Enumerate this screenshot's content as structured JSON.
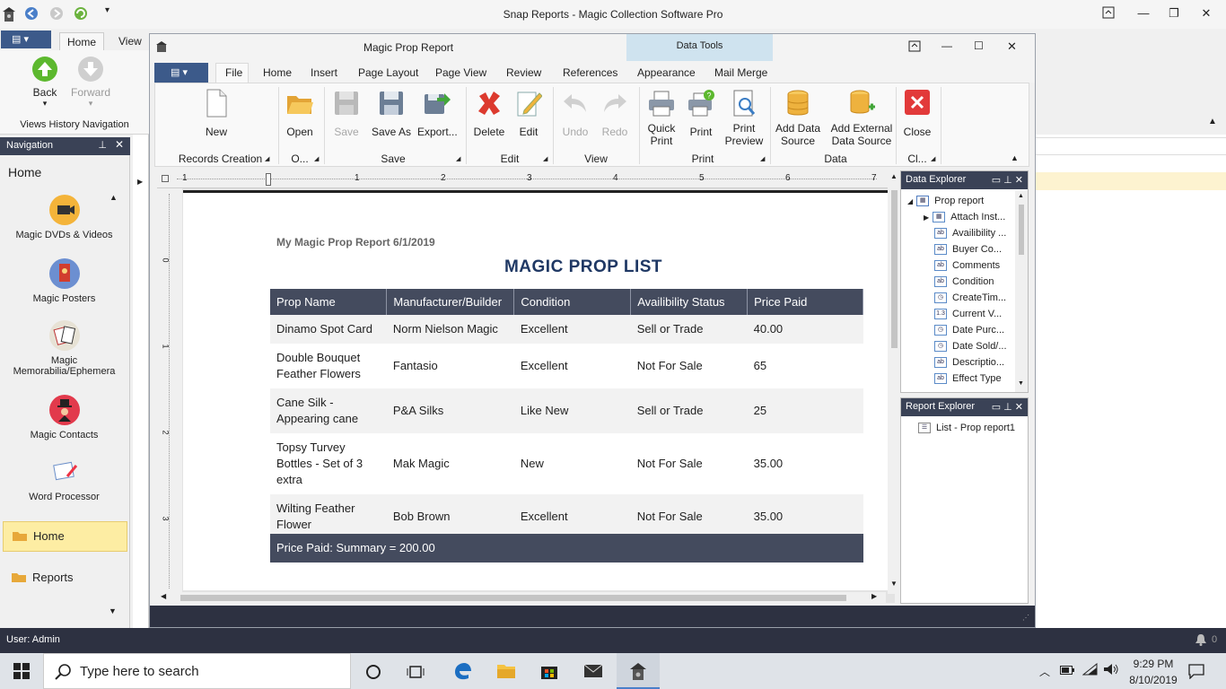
{
  "app": {
    "title": "Snap Reports - Magic Collection Software Pro",
    "tabs": [
      "Home",
      "View"
    ],
    "history": {
      "back": "Back",
      "forward": "Forward",
      "group": "Views History Navigation"
    }
  },
  "navigation": {
    "title": "Navigation",
    "home_label": "Home",
    "items": [
      {
        "label": "Magic DVDs & Videos",
        "icon": "video-camera-icon"
      },
      {
        "label": "Magic Posters",
        "icon": "poster-icon"
      },
      {
        "label": "Magic Memorabilia/Ephemera",
        "icon": "cards-icon"
      },
      {
        "label": "Magic Contacts",
        "icon": "magician-icon"
      },
      {
        "label": "Word Processor",
        "icon": "document-pen-icon"
      }
    ],
    "bottom_items": [
      {
        "label": "Home"
      },
      {
        "label": "Reports"
      }
    ]
  },
  "report_window": {
    "title": "Magic Prop Report",
    "contextual_tab": "Data Tools",
    "tabs": [
      "File",
      "Home",
      "Insert",
      "Page Layout",
      "Page View",
      "Review",
      "References",
      "Appearance",
      "Mail Merge"
    ],
    "buttons": {
      "new": "New",
      "open": "Open",
      "save": "Save",
      "save_as": "Save As",
      "export": "Export...",
      "delete": "Delete",
      "edit": "Edit",
      "undo": "Undo",
      "redo": "Redo",
      "quick_print_1": "Quick",
      "quick_print_2": "Print",
      "print": "Print",
      "print_preview_1": "Print",
      "print_preview_2": "Preview",
      "add_ds_1": "Add Data",
      "add_ds_2": "Source",
      "add_ext_1": "Add External",
      "add_ext_2": "Data Source",
      "close": "Close"
    },
    "groups": {
      "records_creation": "Records Creation",
      "open": "O...",
      "save": "Save",
      "edit": "Edit",
      "view": "View",
      "print": "Print",
      "data": "Data",
      "close": "Cl..."
    },
    "ruler_numbers": [
      "1",
      "1",
      "2",
      "3",
      "4",
      "5",
      "6",
      "7"
    ],
    "ruler_v_numbers": [
      "0",
      "1",
      "2",
      "3"
    ]
  },
  "report": {
    "subtitle": "My Magic Prop Report 6/1/2019",
    "title": "MAGIC PROP LIST",
    "columns": [
      "Prop Name",
      "Manufacturer/Builder",
      "Condition",
      "Availibility Status",
      "Price Paid"
    ],
    "rows": [
      [
        "Dinamo Spot Card",
        "Norm Nielson Magic",
        "Excellent",
        "Sell or Trade",
        "40.00"
      ],
      [
        "Double Bouquet Feather Flowers",
        "Fantasio",
        "Excellent",
        "Not For Sale",
        "65"
      ],
      [
        "Cane Silk - Appearing cane",
        "P&A Silks",
        "Like New",
        "Sell or Trade",
        "25"
      ],
      [
        "Topsy Turvey Bottles - Set of 3 extra",
        "Mak Magic",
        "New",
        "Not For Sale",
        "35.00"
      ],
      [
        "Wilting Feather Flower",
        "Bob Brown",
        "Excellent",
        "Not For Sale",
        "35.00"
      ]
    ],
    "summary": "Price Paid: Summary = 200.00"
  },
  "data_explorer": {
    "title": "Data Explorer",
    "root": "Prop report",
    "fields": [
      {
        "label": "Attach Inst...",
        "type": "table"
      },
      {
        "label": "Availibility ...",
        "type": "ab"
      },
      {
        "label": "Buyer Co...",
        "type": "ab"
      },
      {
        "label": "Comments",
        "type": "ab"
      },
      {
        "label": "Condition",
        "type": "ab"
      },
      {
        "label": "CreateTim...",
        "type": "clock"
      },
      {
        "label": "Current V...",
        "type": "1.3"
      },
      {
        "label": "Date Purc...",
        "type": "clock"
      },
      {
        "label": "Date Sold/...",
        "type": "clock"
      },
      {
        "label": "Descriptio...",
        "type": "ab"
      },
      {
        "label": "Effect Type",
        "type": "ab"
      }
    ]
  },
  "report_explorer": {
    "title": "Report Explorer",
    "item": "List - Prop report1"
  },
  "status": {
    "user": "User: Admin",
    "badge": "0"
  },
  "taskbar": {
    "search_placeholder": "Type here to search",
    "time": "9:29 PM",
    "date": "8/10/2019"
  },
  "colors": {
    "header_dark": "#444b5e",
    "panel_head": "#3a4256",
    "title_blue": "#1f3864",
    "highlight": "#fdeda3"
  }
}
